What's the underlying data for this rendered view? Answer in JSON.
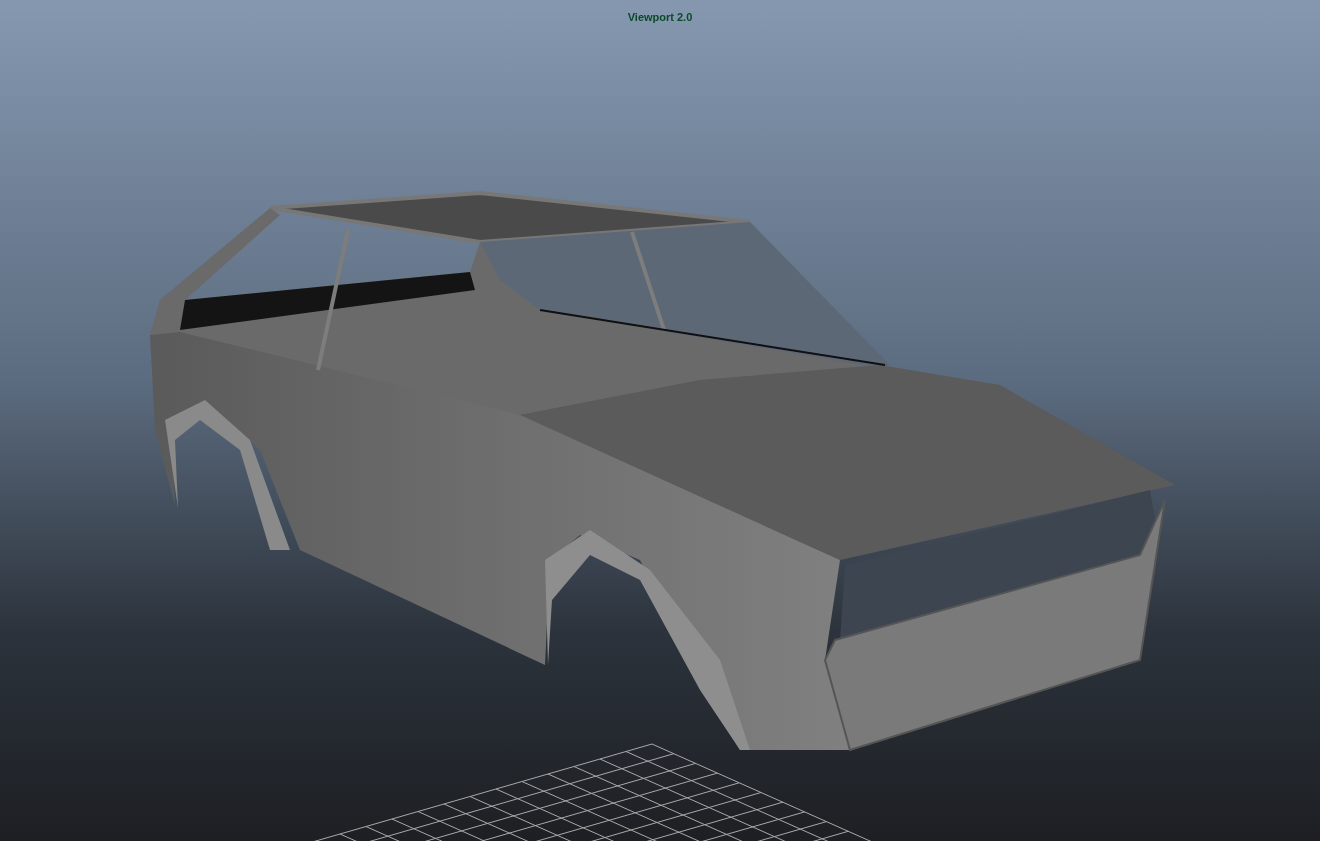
{
  "viewport": {
    "title": "Viewport 2.0"
  }
}
